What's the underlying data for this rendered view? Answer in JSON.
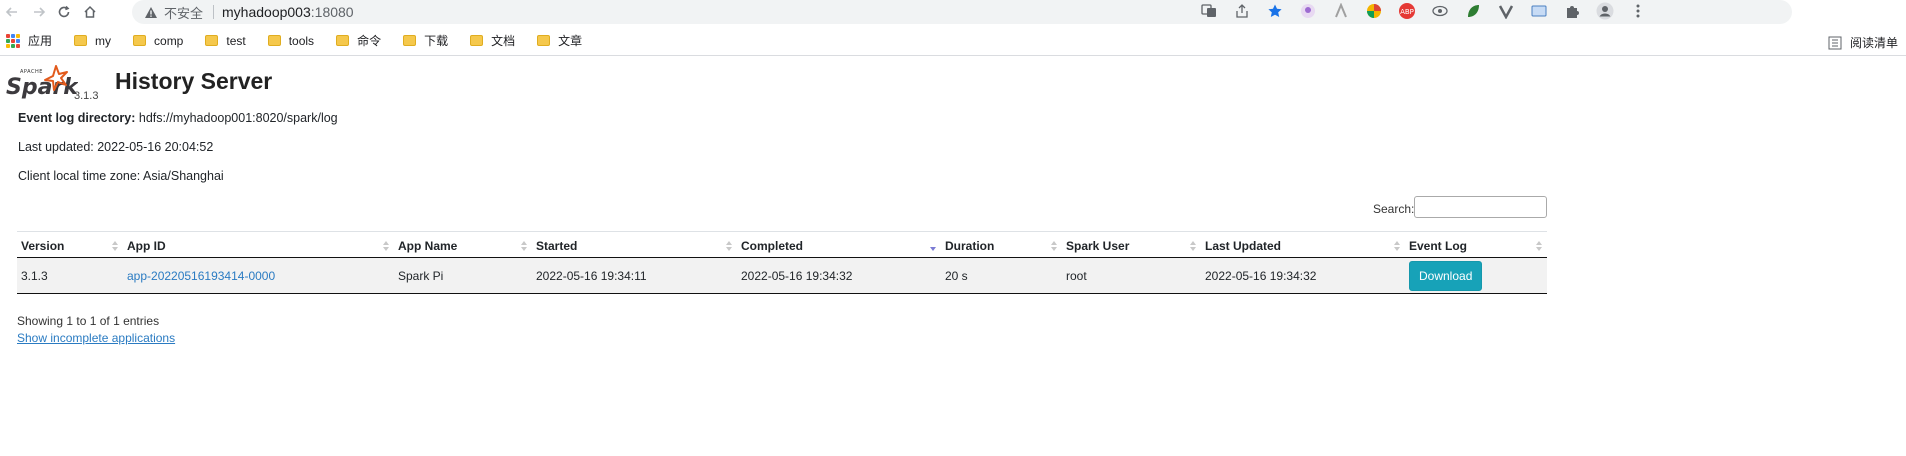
{
  "browser": {
    "insecure_label": "不安全",
    "url_host": "myhadoop003",
    "url_port": ":18080",
    "bookmarks": [
      {
        "label": "应用",
        "type": "apps"
      },
      {
        "label": "my",
        "type": "folder"
      },
      {
        "label": "comp",
        "type": "folder"
      },
      {
        "label": "test",
        "type": "folder"
      },
      {
        "label": "tools",
        "type": "folder"
      },
      {
        "label": "命令",
        "type": "folder"
      },
      {
        "label": "下载",
        "type": "folder"
      },
      {
        "label": "文档",
        "type": "folder"
      },
      {
        "label": "文章",
        "type": "folder"
      }
    ],
    "reading_list_label": "阅读清单"
  },
  "header": {
    "spark_version": "3.1.3",
    "title": "History Server"
  },
  "info": {
    "event_log_label": "Event log directory:",
    "event_log_value": "hdfs://myhadoop001:8020/spark/log",
    "last_updated": "Last updated: 2022-05-16 20:04:52",
    "timezone": "Client local time zone: Asia/Shanghai"
  },
  "search": {
    "label": "Search:",
    "value": ""
  },
  "table": {
    "columns": [
      "Version",
      "App ID",
      "App Name",
      "Started",
      "Completed",
      "Duration",
      "Spark User",
      "Last Updated",
      "Event Log"
    ],
    "rows": [
      {
        "version": "3.1.3",
        "app_id": "app-20220516193414-0000",
        "app_name": "Spark Pi",
        "started": "2022-05-16 19:34:11",
        "completed": "2022-05-16 19:34:32",
        "duration": "20 s",
        "spark_user": "root",
        "last_updated": "2022-05-16 19:34:32",
        "event_log_button": "Download"
      }
    ]
  },
  "footer": {
    "showing": "Showing 1 to 1 of 1 entries",
    "incomplete_link": "Show incomplete applications"
  },
  "colors": {
    "link": "#2a7bc2",
    "download_button": "#17a2b8",
    "sort_active": "#7b7bd4"
  }
}
